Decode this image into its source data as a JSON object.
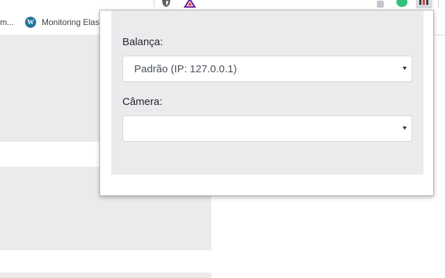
{
  "browser": {
    "bookmarks": [
      {
        "label": "m...",
        "icon": "generic-page-icon"
      },
      {
        "label": "Monitoring Elas",
        "icon": "wordpress-icon"
      }
    ],
    "extensions": [
      "shield-icon",
      "prism-icon",
      "grey-puzzle-icon",
      "grammarly-icon",
      "active-extension-icon"
    ]
  },
  "popup": {
    "scale_label": "Balança:",
    "scale_selected": "Padrão (IP: 127.0.0.1)",
    "camera_label": "Câmera:",
    "camera_selected": ""
  },
  "colors": {
    "panel_background": "#ebebed",
    "wordpress_blue": "#21759b",
    "grammarly_green": "#2ec27e"
  }
}
